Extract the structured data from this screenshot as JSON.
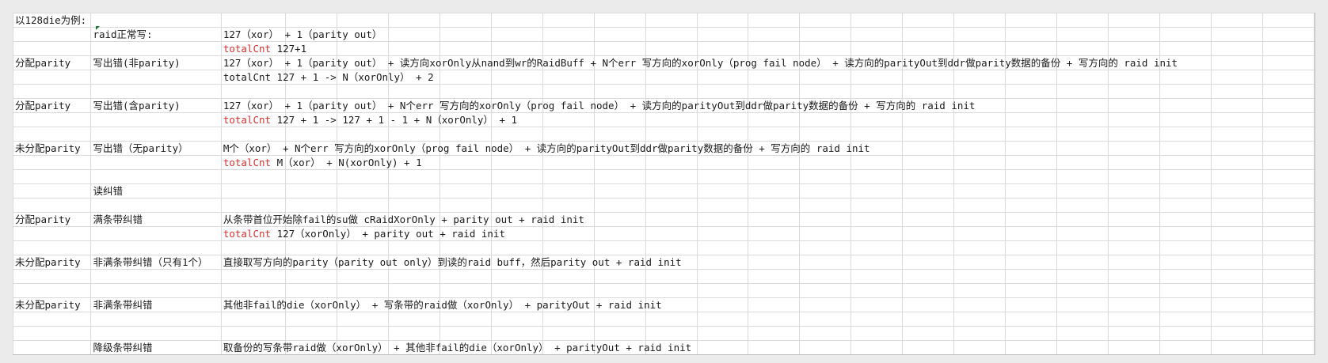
{
  "title": "以128die为例:",
  "rows": [
    {
      "a": "以128die为例:",
      "b": "",
      "c_label": "",
      "c": ""
    },
    {
      "a": "",
      "b": "raid正常写:",
      "c_label": "",
      "c": "127（xor） + 1（parity out）"
    },
    {
      "a": "",
      "b": "",
      "c_label": "totalCnt",
      "c": "127+1"
    },
    {
      "a": "分配parity",
      "b": "写出错(非parity)",
      "c_label": "",
      "c": "127（xor） + 1（parity out） +  读方向xorOnly从nand到wr的RaidBuff  + N个err 写方向的xorOnly（prog fail node） + 读方向的parityOut到ddr做parity数据的备份 + 写方向的 raid init"
    },
    {
      "a": "",
      "b": "",
      "c_label": "",
      "c": "totalCnt 127 + 1 -> N（xorOnly） + 2"
    },
    {
      "a": "",
      "b": "",
      "c_label": "",
      "c": ""
    },
    {
      "a": "分配parity",
      "b": "写出错(含parity)",
      "c_label": "",
      "c": "127（xor） + 1（parity out） +  N个err 写方向的xorOnly（prog fail node） + 读方向的parityOut到ddr做parity数据的备份 + 写方向的 raid init"
    },
    {
      "a": "",
      "b": "",
      "c_label": "totalCnt",
      "c": "127 + 1 -> 127 + 1 - 1 + N（xorOnly） + 1"
    },
    {
      "a": "",
      "b": "",
      "c_label": "",
      "c": ""
    },
    {
      "a": "未分配parity",
      "b": "写出错（无parity）",
      "c_label": "",
      "c": "M个（xor） +  N个err 写方向的xorOnly（prog fail node） + 读方向的parityOut到ddr做parity数据的备份 + 写方向的 raid init"
    },
    {
      "a": "",
      "b": "",
      "c_label": "totalCnt",
      "c": "M（xor） + N(xorOnly) + 1"
    },
    {
      "a": "",
      "b": "",
      "c_label": "",
      "c": ""
    },
    {
      "a": "",
      "b": "读纠错",
      "c_label": "",
      "c": ""
    },
    {
      "a": "",
      "b": "",
      "c_label": "",
      "c": ""
    },
    {
      "a": "分配parity",
      "b": "满条带纠错",
      "c_label": "",
      "c": "从条带首位开始除fail的su做 cRaidXorOnly + parity out + raid init"
    },
    {
      "a": "",
      "b": "",
      "c_label": "totalCnt",
      "c": "127（xorOnly） + parity out + raid init"
    },
    {
      "a": "",
      "b": "",
      "c_label": "",
      "c": ""
    },
    {
      "a": "未分配parity",
      "b": "非满条带纠错（只有1个）",
      "c_label": "",
      "c": "直接取写方向的parity（parity out only）到读的raid buff，然后parity out + raid init"
    },
    {
      "a": "",
      "b": "",
      "c_label": "",
      "c": ""
    },
    {
      "a": "",
      "b": "",
      "c_label": "",
      "c": ""
    },
    {
      "a": "未分配parity",
      "b": "非满条带纠错",
      "c_label": "",
      "c": "其他非fail的die（xorOnly） + 写条带的raid做（xorOnly） + parityOut + raid init"
    },
    {
      "a": "",
      "b": "",
      "c_label": "",
      "c": ""
    },
    {
      "a": "",
      "b": "",
      "c_label": "",
      "c": ""
    },
    {
      "a": "",
      "b": "降级条带纠错",
      "c_label": "",
      "c": "取备份的写条带raid做（xorOnly） + 其他非fail的die（xorOnly） + parityOut + raid init"
    }
  ],
  "colors": {
    "label_red": "#d9302c",
    "grid": "#dadada",
    "background": "#ebebeb"
  }
}
